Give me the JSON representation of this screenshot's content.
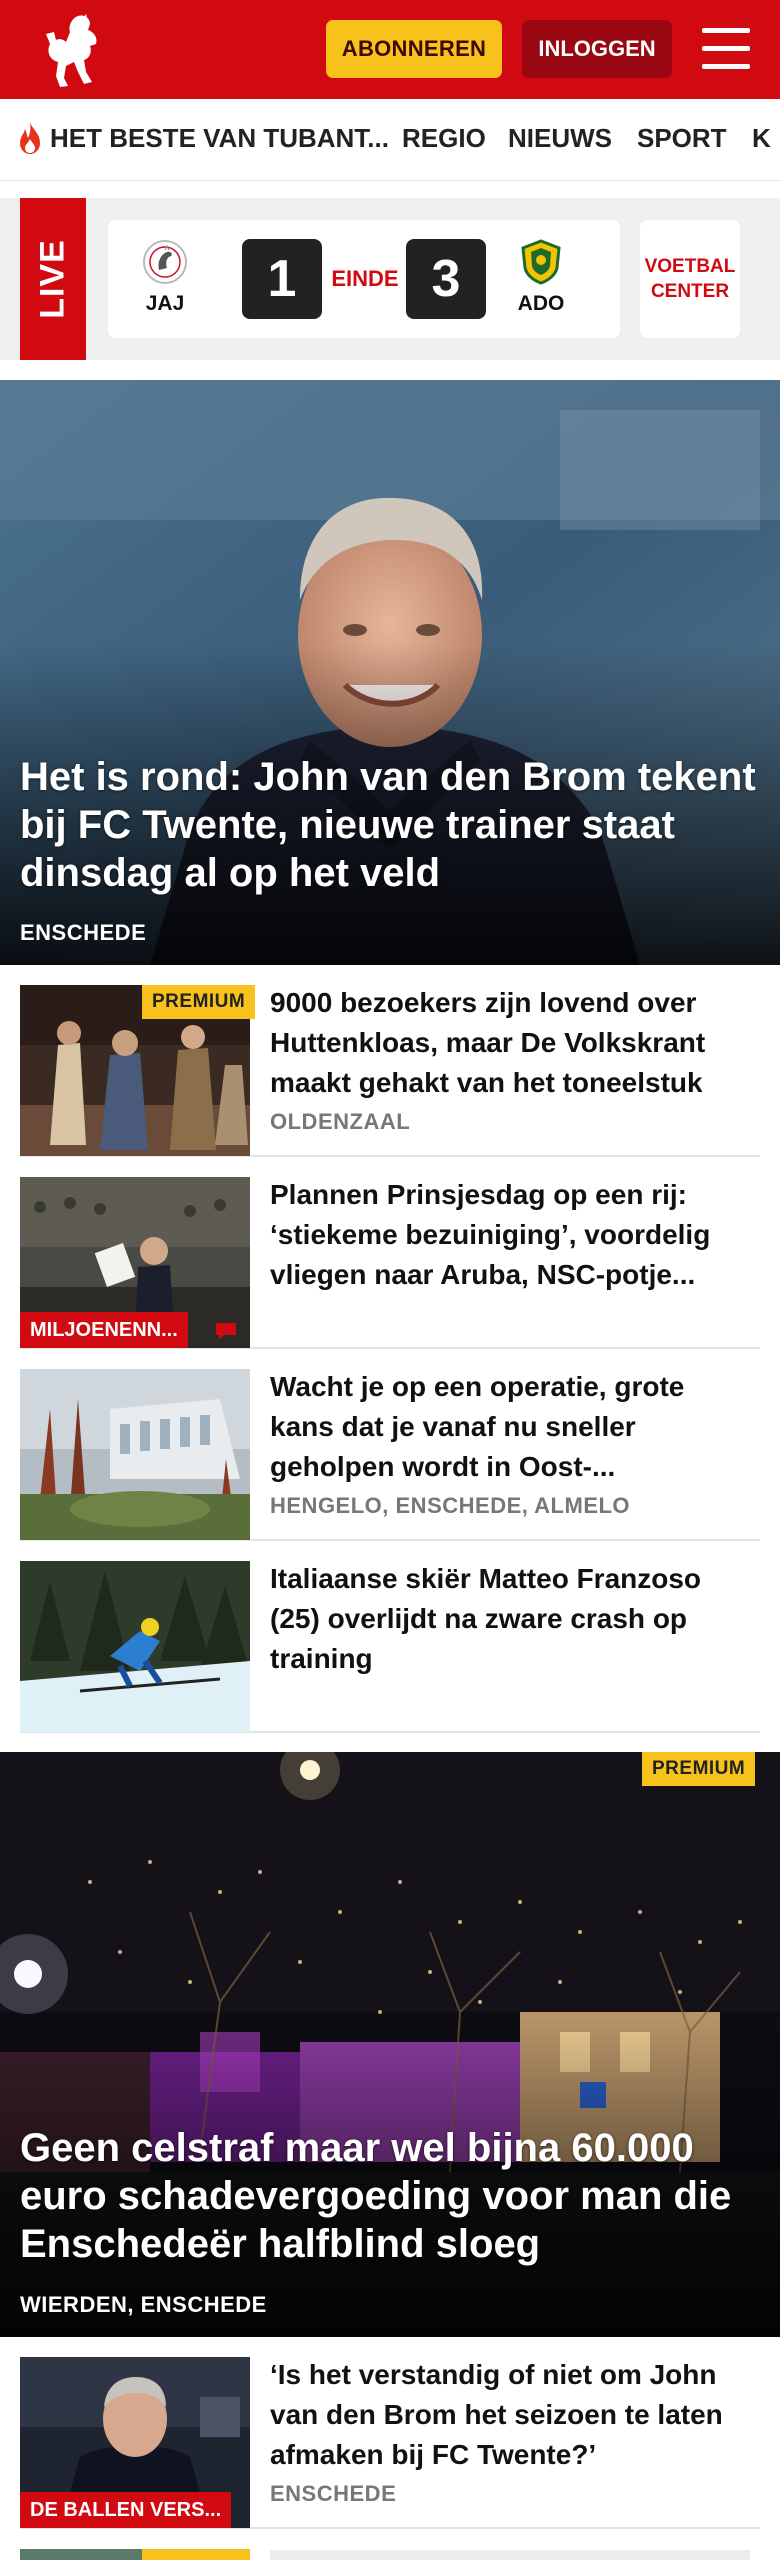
{
  "header": {
    "subscribe_label": "ABONNEREN",
    "login_label": "INLOGGEN"
  },
  "nav": {
    "items": [
      "HET BESTE VAN TUBANT...",
      "REGIO",
      "NIEUWS",
      "SPORT",
      "K"
    ]
  },
  "live": {
    "tag": "LIVE",
    "home_team": "JAJ",
    "home_score": "1",
    "status": "EINDE",
    "away_score": "3",
    "away_team": "ADO",
    "center_label": "VOETBAL CENTER"
  },
  "hero": {
    "title": "Het is rond: John van den Brom tekent bij FC Twente, nieuwe trainer staat dinsdag al op het veld",
    "location": "ENSCHEDE"
  },
  "articles": [
    {
      "title": "9000 bezoekers zijn lovend over Huttenkloas, maar De Volkskrant maakt gehakt van het toneelstuk",
      "location": "OLDENZAAL",
      "badge": "PREMIUM"
    },
    {
      "title": "Plannen Prinsjesdag op een rij: ‘stiekeme bezuiniging’, voordelig vliegen naar Aruba, NSC-potje...",
      "category": "MILJOENENN..."
    },
    {
      "title": "Wacht je op een operatie, grote kans dat je vanaf nu sneller geholpen wordt in Oost-...",
      "location": "HENGELO, ENSCHEDE, ALMELO"
    },
    {
      "title": "Italiaanse skiër Matteo Franzoso (25) overlijdt na zware crash op training"
    }
  ],
  "feature": {
    "badge": "PREMIUM",
    "title": "Geen celstraf maar wel bijna 60.000 euro schadevergoeding voor man die Enschedeër halfblind sloeg",
    "location": "WIERDEN, ENSCHEDE"
  },
  "article_last": {
    "title": "‘Is het verstandig of niet om John van den Brom het seizoen te laten afmaken bij FC Twente?’",
    "location": "ENSCHEDE",
    "category": "DE BALLEN VERS..."
  },
  "colors": {
    "brand_red": "#d10a11",
    "subscribe_yellow": "#f8c21c",
    "login_dark_red": "#990812"
  },
  "icons": [
    "tubantia-horse-logo",
    "menu-icon",
    "flame-icon",
    "ajax-crest-icon",
    "ado-crest-icon",
    "comment-icon"
  ]
}
